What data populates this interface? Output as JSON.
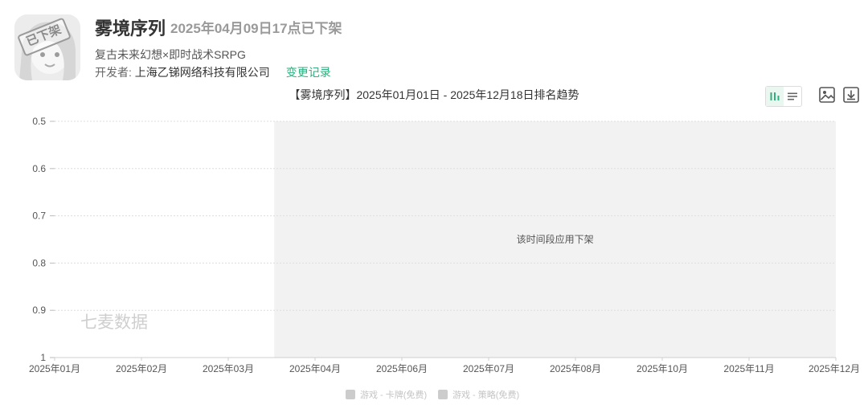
{
  "app": {
    "badge": "已下架",
    "title": "雾境序列",
    "status": "2025年04月09日17点已下架",
    "subtitle": "复古未来幻想×即时战术SRPG",
    "developer_label": "开发者: ",
    "developer_name": "上海乙锑网络科技有限公司",
    "change_log_label": "变更记录"
  },
  "toolbar": {
    "icons": [
      "bar-list-toggle-icon",
      "list-lines-icon",
      "image-export-icon",
      "download-icon"
    ],
    "accent": "#2fae7e"
  },
  "chart_data": {
    "type": "line",
    "title": "【雾境序列】2025年01月01日 - 2025年12月18日排名趋势",
    "xlabel": "",
    "ylabel": "",
    "x_tick_labels": [
      "2025年01月",
      "2025年02月",
      "2025年03月",
      "2025年04月",
      "2025年06月",
      "2025年07月",
      "2025年08月",
      "2025年10月",
      "2025年11月",
      "2025年12月"
    ],
    "x_range": [
      0,
      9
    ],
    "y_ticks": [
      0.5,
      0.6,
      0.7,
      0.8,
      0.9,
      1
    ],
    "y_tick_labels": [
      "0.5",
      "0.6",
      "0.7",
      "0.8",
      "0.9",
      "1"
    ],
    "ylim": [
      0.5,
      1
    ],
    "y_inverted": true,
    "grid": true,
    "series": [
      {
        "name": "游戏 - 卡牌(免费)",
        "values": [],
        "color": "#cccccc"
      },
      {
        "name": "游戏 - 策略(免费)",
        "values": [],
        "color": "#cccccc"
      }
    ],
    "delisted_region": {
      "from": 2.53,
      "to": 9
    },
    "delisted_label": "该时间段应用下架",
    "delisted_color": "#f2f2f2",
    "watermark": "七麦数据",
    "legend": "bottom-center"
  }
}
